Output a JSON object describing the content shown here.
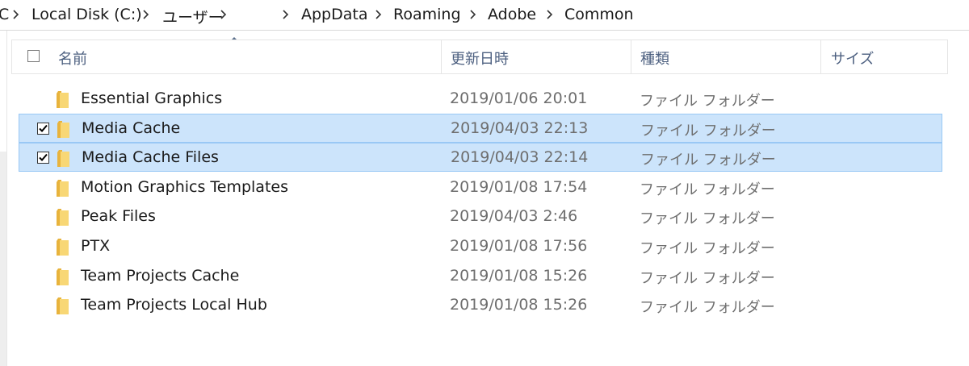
{
  "breadcrumb": {
    "items": [
      "C",
      "Local Disk (C:)",
      "ユーザー",
      "AppData",
      "Roaming",
      "Adobe",
      "Common"
    ]
  },
  "columns": {
    "name": "名前",
    "date": "更新日時",
    "type": "種類",
    "size": "サイズ"
  },
  "files": [
    {
      "name": "Essential Graphics",
      "date": "2019/01/06 20:01",
      "type": "ファイル フォルダー",
      "selected": false
    },
    {
      "name": "Media Cache",
      "date": "2019/04/03 22:13",
      "type": "ファイル フォルダー",
      "selected": true
    },
    {
      "name": "Media Cache Files",
      "date": "2019/04/03 22:14",
      "type": "ファイル フォルダー",
      "selected": true
    },
    {
      "name": "Motion Graphics Templates",
      "date": "2019/01/08 17:54",
      "type": "ファイル フォルダー",
      "selected": false
    },
    {
      "name": "Peak Files",
      "date": "2019/04/03 2:46",
      "type": "ファイル フォルダー",
      "selected": false
    },
    {
      "name": "PTX",
      "date": "2019/01/08 17:56",
      "type": "ファイル フォルダー",
      "selected": false
    },
    {
      "name": "Team Projects Cache",
      "date": "2019/01/08 15:26",
      "type": "ファイル フォルダー",
      "selected": false
    },
    {
      "name": "Team Projects Local Hub",
      "date": "2019/01/08 15:26",
      "type": "ファイル フォルダー",
      "selected": false
    }
  ],
  "colors": {
    "selection_bg": "#cce4fb",
    "selection_border": "#99c8f5",
    "folder_yellow": "#f8d775",
    "header_text": "#4d6080"
  },
  "icons": {
    "folder": "folder-icon",
    "separator": "chevron-right-icon",
    "sort": "sort-ascending-icon"
  }
}
